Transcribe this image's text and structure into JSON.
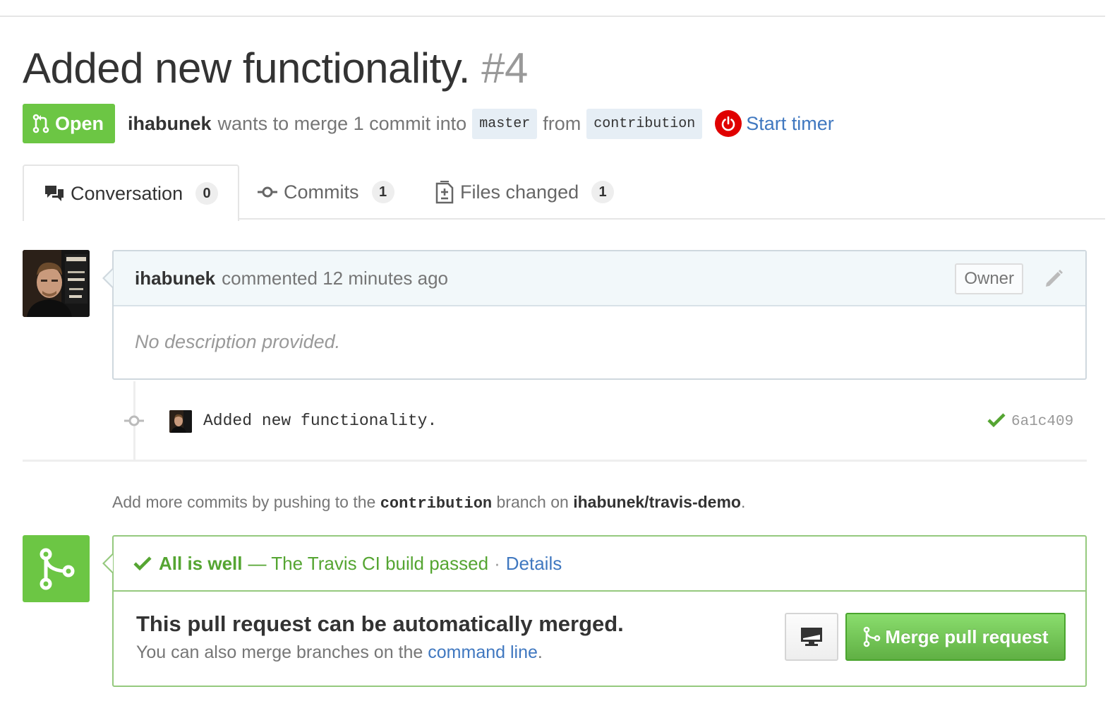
{
  "pr": {
    "title": "Added new functionality.",
    "number": "#4",
    "state": "Open",
    "author": "ihabunek",
    "merge_text": "wants to merge 1 commit into",
    "base_branch": "master",
    "from_text": "from",
    "head_branch": "contribution",
    "timer_label": "Start timer"
  },
  "tabs": [
    {
      "label": "Conversation",
      "count": "0",
      "icon": "comment-discussion-icon"
    },
    {
      "label": "Commits",
      "count": "1",
      "icon": "git-commit-icon"
    },
    {
      "label": "Files changed",
      "count": "1",
      "icon": "file-diff-icon"
    }
  ],
  "comment": {
    "author": "ihabunek",
    "action": "commented",
    "time": "12 minutes ago",
    "role": "Owner",
    "body": "No description provided."
  },
  "commit": {
    "message": "Added new functionality.",
    "sha": "6a1c409",
    "status_color": "#55a532"
  },
  "help": {
    "prefix": "Add more commits by pushing to the",
    "branch": "contribution",
    "middle": "branch on",
    "repo": "ihabunek/travis-demo",
    "suffix": "."
  },
  "merge": {
    "status_strong": "All is well",
    "status_text": "— The Travis CI build passed",
    "dot": "·",
    "details_label": "Details",
    "title": "This pull request can be automatically merged.",
    "sub_prefix": "You can also merge branches on the",
    "sub_link": "command line",
    "sub_suffix": ".",
    "button_label": "Merge pull request"
  },
  "colors": {
    "open_green": "#6cc644",
    "link_blue": "#4078c0",
    "timer_red": "#e00000"
  }
}
